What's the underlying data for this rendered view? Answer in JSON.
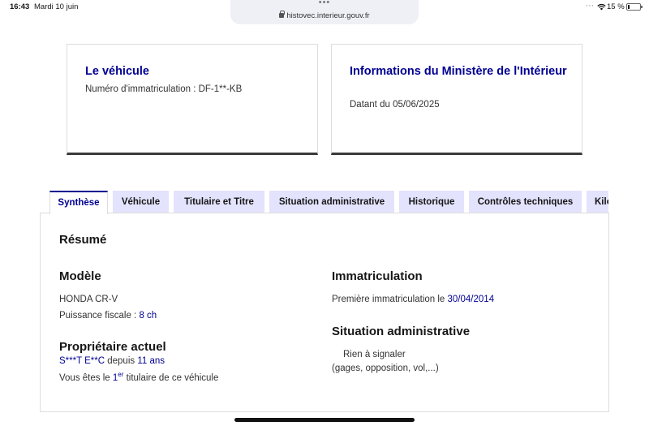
{
  "status_bar": {
    "time": "16:43",
    "date": "Mardi 10 juin",
    "url": "histovec.interieur.gouv.fr",
    "more_dots": "•••",
    "status_dots": "⋯",
    "battery": "15 %",
    "battery_level": 0.15
  },
  "cards": {
    "vehicle": {
      "title": "Le véhicule",
      "plate_line": "Numéro d'immatriculation : DF-1**-KB"
    },
    "ministry": {
      "title": "Informations du Ministère de l'Intérieur",
      "date_line": "Datant du 05/06/2025"
    }
  },
  "tabs": [
    {
      "label": "Synthèse",
      "active": true
    },
    {
      "label": "Véhicule"
    },
    {
      "label": "Titulaire et Titre"
    },
    {
      "label": "Situation administrative"
    },
    {
      "label": "Historique"
    },
    {
      "label": "Contrôles techniques"
    },
    {
      "label": "Kilométrage"
    }
  ],
  "summary": {
    "title": "Résumé",
    "model": {
      "heading": "Modèle",
      "name": "HONDA CR-V",
      "power_label": "Puissance fiscale :",
      "power_value": "8 ch"
    },
    "owner": {
      "heading": "Propriétaire actuel",
      "name": "S***T E**C",
      "since_label": "depuis",
      "since_value": "11 ans",
      "line_prefix": "Vous êtes le",
      "rank": "1",
      "rank_sup": "er",
      "line_suffix": "titulaire de ce véhicule"
    },
    "registration": {
      "heading": "Immatriculation",
      "first_label": "Première immatriculation le",
      "first_date": "30/04/2014"
    },
    "admin": {
      "heading": "Situation administrative",
      "status": "Rien à signaler",
      "note": "(gages, opposition, vol,...)"
    }
  }
}
